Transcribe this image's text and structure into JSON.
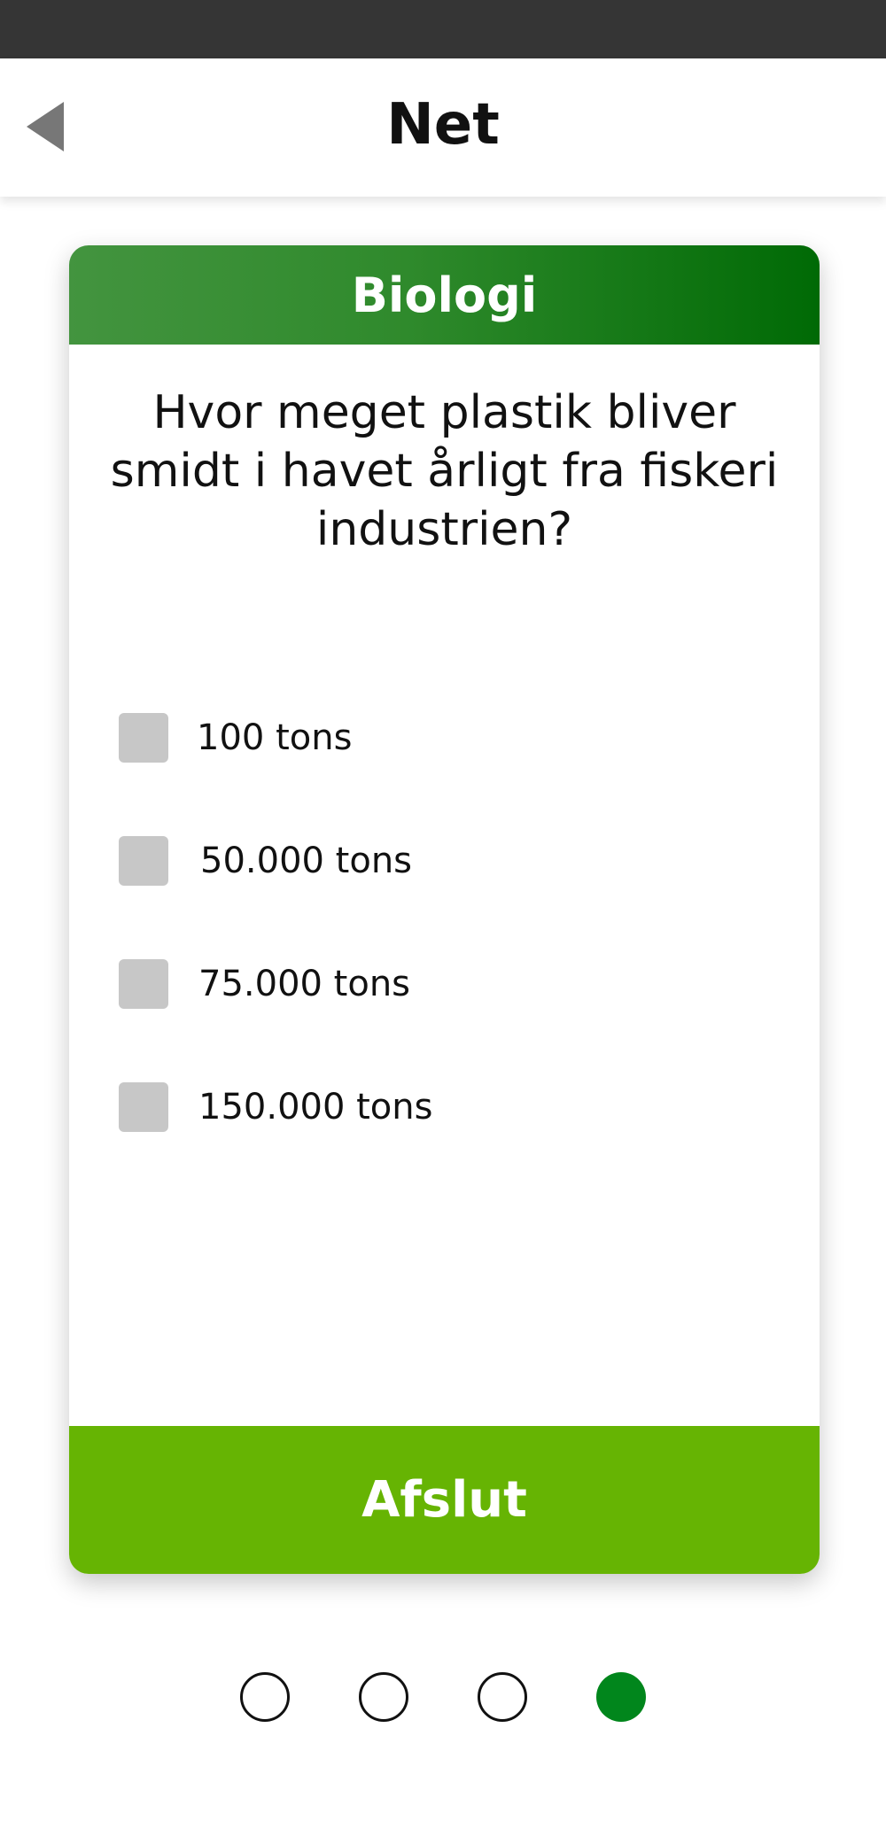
{
  "header": {
    "title": "Net"
  },
  "card": {
    "category": "Biologi",
    "question": "Hvor meget plastik bliver smidt i havet årligt fra fiskeri industrien?",
    "options": [
      {
        "label": "100 tons",
        "checked": false
      },
      {
        "label": "50.000 tons",
        "checked": false
      },
      {
        "label": "75.000 tons",
        "checked": false
      },
      {
        "label": "150.000 tons",
        "checked": false
      }
    ],
    "finish_label": "Afslut"
  },
  "pager": {
    "total": 4,
    "active_index": 3
  },
  "colors": {
    "status_bar": "#353535",
    "header_gradient_start": "#43943f",
    "header_gradient_end": "#006a05",
    "finish_button": "#66b403",
    "active_dot": "#01861c",
    "checkbox": "#c7c7c7"
  }
}
